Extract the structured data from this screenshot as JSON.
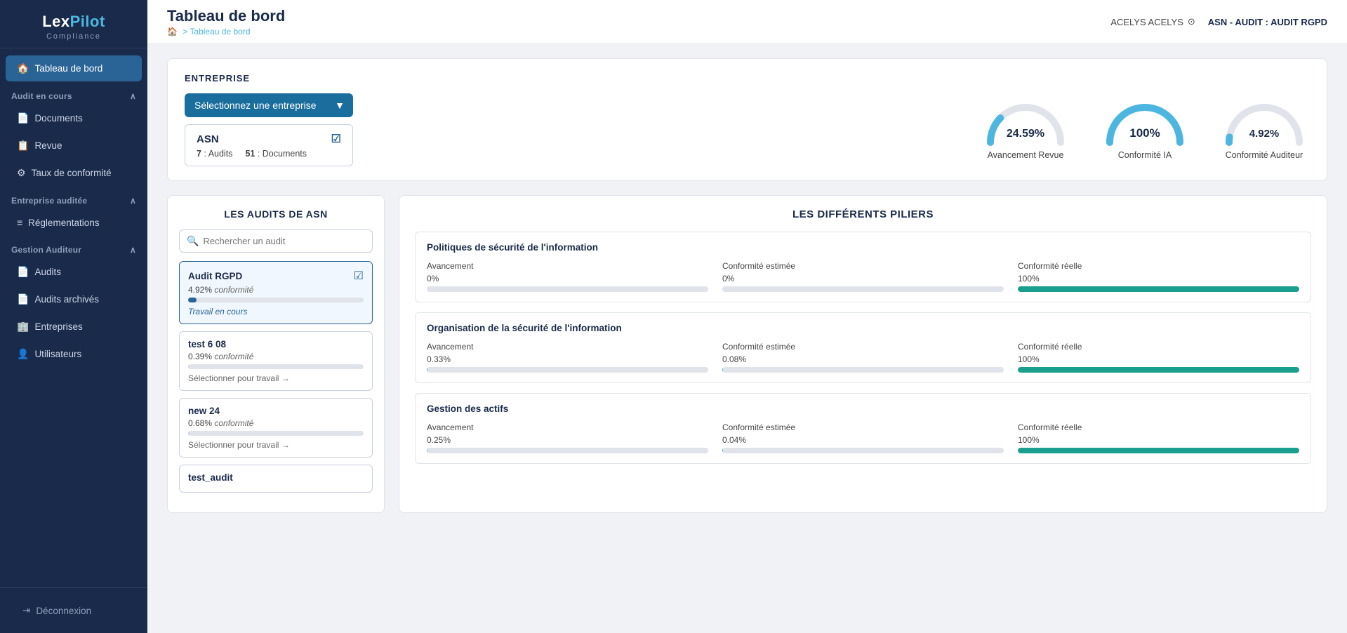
{
  "app": {
    "name": "LexPilot",
    "sub": "Compliance"
  },
  "topbar": {
    "title": "Tableau de bord",
    "breadcrumb_icon": "🏠",
    "breadcrumb_text": "> Tableau de bord",
    "user": "ACELYS ACELYS",
    "audit_label": "ASN - AUDIT : AUDIT RGPD"
  },
  "sidebar": {
    "active_item": "tableau-de-bord",
    "nav_items": [
      {
        "id": "tableau-de-bord",
        "label": "Tableau de bord",
        "icon": "🏠",
        "active": true
      }
    ],
    "section_audit_en_cours": "Audit en cours",
    "audit_items": [
      {
        "id": "documents",
        "label": "Documents",
        "icon": "📄"
      },
      {
        "id": "revue",
        "label": "Revue",
        "icon": "📋"
      },
      {
        "id": "taux-conformite",
        "label": "Taux de conformité",
        "icon": "⚙"
      }
    ],
    "section_entreprise": "Entreprise auditée",
    "entreprise_items": [
      {
        "id": "reglementations",
        "label": "Réglementations",
        "icon": "≡"
      }
    ],
    "section_gestion": "Gestion Auditeur",
    "gestion_items": [
      {
        "id": "audits",
        "label": "Audits",
        "icon": "📄"
      },
      {
        "id": "audits-archives",
        "label": "Audits archivés",
        "icon": "📄"
      },
      {
        "id": "entreprises",
        "label": "Entreprises",
        "icon": "🏢"
      },
      {
        "id": "utilisateurs",
        "label": "Utilisateurs",
        "icon": "👤"
      }
    ],
    "deconnexion": "Déconnexion"
  },
  "entreprise": {
    "section_title": "ENTREPRISE",
    "select_placeholder": "Sélectionnez une entreprise",
    "company": {
      "name": "ASN",
      "audits_count": "7",
      "audits_label": ": Audits",
      "docs_count": "51",
      "docs_label": ": Documents"
    }
  },
  "gauges": [
    {
      "id": "avancement-revue",
      "value": 24.59,
      "label": "Avancement Revue",
      "percent_text": "24.59%",
      "color": "#4db6e0",
      "track_color": "#e0e4ea",
      "start_angle": -180,
      "sweep": 180
    },
    {
      "id": "conformite-ia",
      "value": 100,
      "label": "Conformité IA",
      "percent_text": "100%",
      "color": "#4db6e0",
      "track_color": "#e0e4ea"
    },
    {
      "id": "conformite-auditeur",
      "value": 4.92,
      "label": "Conformité Auditeur",
      "percent_text": "4.92%",
      "color": "#4db6e0",
      "track_color": "#e0e4ea"
    }
  ],
  "audits_panel": {
    "title": "LES AUDITS DE ASN",
    "search_placeholder": "Rechercher un audit",
    "audits": [
      {
        "id": "audit-rgpd",
        "name": "Audit RGPD",
        "conformite": "4.92%",
        "conformite_label": "conformité",
        "progress": 4.92,
        "status": "Travail en cours",
        "link": null,
        "selected": true,
        "color": "#2a6496"
      },
      {
        "id": "test-6-08",
        "name": "test 6 08",
        "conformite": "0.39%",
        "conformite_label": "conformité",
        "progress": 0.39,
        "status": null,
        "link": "Sélectionner pour travail →",
        "selected": false,
        "color": "#c8d0e0"
      },
      {
        "id": "new-24",
        "name": "new 24",
        "conformite": "0.68%",
        "conformite_label": "conformité",
        "progress": 0.68,
        "status": null,
        "link": "Sélectionner pour travail →",
        "selected": false,
        "color": "#c8d0e0"
      },
      {
        "id": "test-audit",
        "name": "test_audit",
        "conformite": null,
        "conformite_label": null,
        "progress": 0,
        "status": null,
        "link": null,
        "selected": false,
        "color": "#c8d0e0"
      }
    ]
  },
  "pillars_panel": {
    "title": "LES DIFFÉRENTS PILIERS",
    "pillars": [
      {
        "id": "politiques-securite",
        "title": "Politiques de sécurité de l'information",
        "metrics": [
          {
            "label": "Avancement",
            "value": "0%",
            "fill_percent": 0,
            "color": "#4db6e0"
          },
          {
            "label": "Conformité estimée",
            "value": "0%",
            "fill_percent": 0,
            "color": "#4db6e0"
          },
          {
            "label": "Conformité réelle",
            "value": "100%",
            "fill_percent": 100,
            "color": "#1a9e8e"
          }
        ]
      },
      {
        "id": "organisation-securite",
        "title": "Organisation de la sécurité de l'information",
        "metrics": [
          {
            "label": "Avancement",
            "value": "0.33%",
            "fill_percent": 0.33,
            "color": "#4db6e0"
          },
          {
            "label": "Conformité estimée",
            "value": "0.08%",
            "fill_percent": 0.08,
            "color": "#4db6e0"
          },
          {
            "label": "Conformité réelle",
            "value": "100%",
            "fill_percent": 100,
            "color": "#1a9e8e"
          }
        ]
      },
      {
        "id": "gestion-actifs",
        "title": "Gestion des actifs",
        "metrics": [
          {
            "label": "Avancement",
            "value": "0.25%",
            "fill_percent": 0.25,
            "color": "#4db6e0"
          },
          {
            "label": "Conformité estimée",
            "value": "0.04%",
            "fill_percent": 0.04,
            "color": "#4db6e0"
          },
          {
            "label": "Conformité réelle",
            "value": "100%",
            "fill_percent": 100,
            "color": "#1a9e8e"
          }
        ]
      }
    ]
  }
}
